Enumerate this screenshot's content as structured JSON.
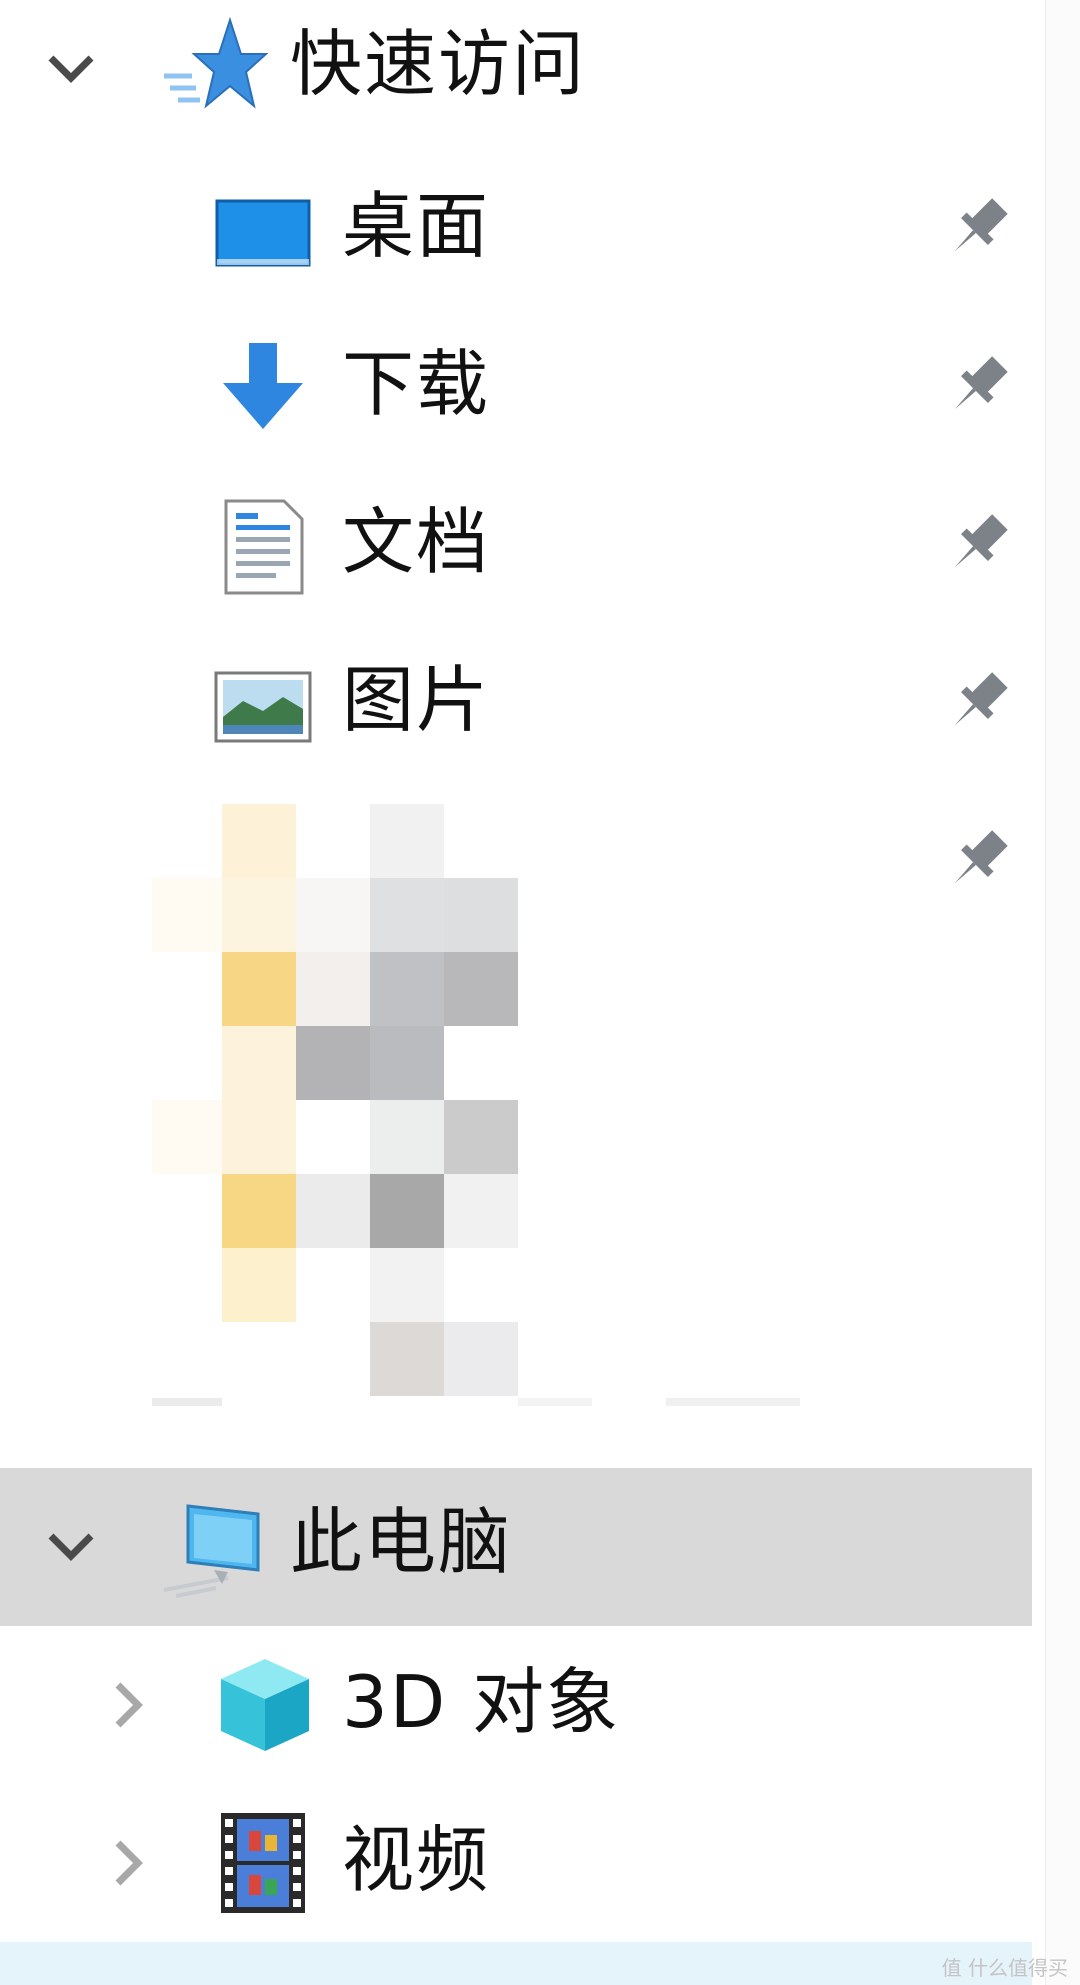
{
  "nav": {
    "quick_access": {
      "label": "快速访问",
      "icon": "star-icon",
      "expanded": true,
      "items": [
        {
          "label": "桌面",
          "icon": "desktop-icon",
          "pinned": true
        },
        {
          "label": "下载",
          "icon": "download-arrow-icon",
          "pinned": true
        },
        {
          "label": "文档",
          "icon": "document-icon",
          "pinned": true
        },
        {
          "label": "图片",
          "icon": "pictures-icon",
          "pinned": true
        },
        {
          "label": "",
          "icon": "pixelated-folder-icon",
          "pinned": true
        }
      ]
    },
    "this_pc": {
      "label": "此电脑",
      "icon": "computer-icon",
      "expanded": true,
      "selected": true,
      "items": [
        {
          "label": "3D 对象",
          "icon": "cube-3d-icon",
          "expandable": true
        },
        {
          "label": "视频",
          "icon": "film-strip-icon",
          "expandable": true
        }
      ]
    }
  },
  "colors": {
    "selected_row": "#d9d9d9",
    "hover_row": "#e5f3fb",
    "star_blue": "#3b8fe0",
    "pin_gray": "#7d8288"
  },
  "watermark": "值 什么值得买"
}
